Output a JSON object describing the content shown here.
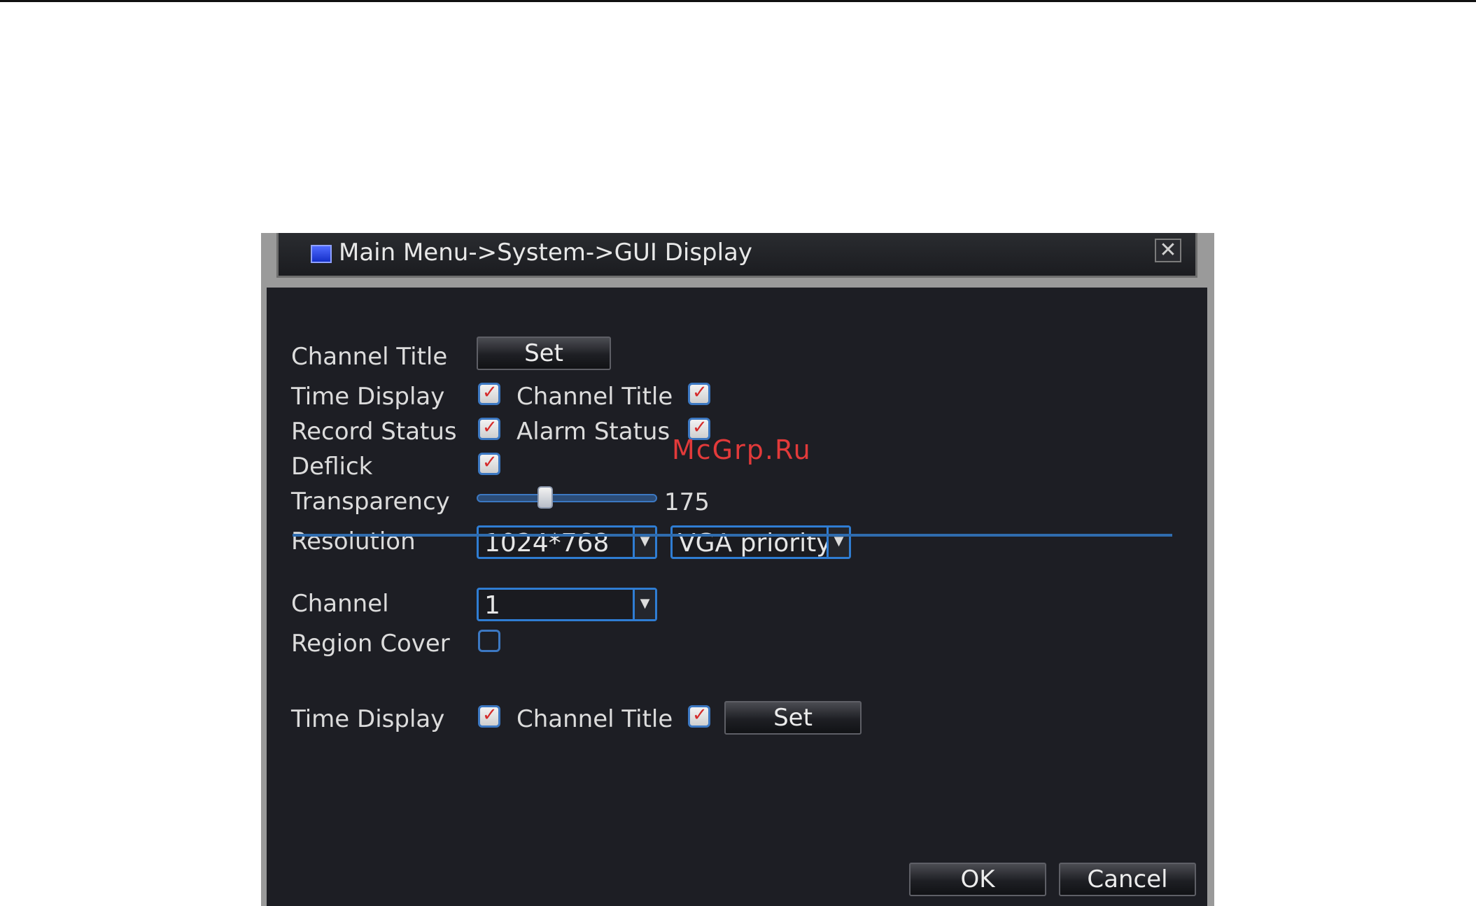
{
  "window": {
    "title": "Main Menu->System->GUI Display",
    "close_label": "✕"
  },
  "rows": {
    "channel_title": {
      "label": "Channel Title",
      "set_label": "Set"
    },
    "time_display": {
      "label": "Time Display",
      "checked": true
    },
    "channel_title_chk": {
      "label": "Channel Title",
      "checked": true
    },
    "record_status": {
      "label": "Record Status",
      "checked": true
    },
    "alarm_status": {
      "label": "Alarm Status",
      "checked": true
    },
    "deflick": {
      "label": "Deflick",
      "checked": true
    },
    "transparency": {
      "label": "Transparency",
      "value": "175"
    },
    "resolution": {
      "label": "Resolution",
      "value": "1024*768",
      "mode": "VGA priority"
    }
  },
  "channel_section": {
    "channel_label": "Channel",
    "channel_value": "1",
    "region_cover_label": "Region Cover",
    "region_cover_checked": false,
    "time_display_label": "Time Display",
    "time_display_checked": true,
    "channel_title_label": "Channel Title",
    "channel_title_checked": true,
    "set_label": "Set"
  },
  "footer": {
    "ok_label": "OK",
    "cancel_label": "Cancel"
  },
  "watermark": "McGrp.Ru",
  "colors": {
    "panel": "#1d1e24",
    "accent_blue": "#2f7dd3",
    "check_red": "#d52a2a"
  }
}
